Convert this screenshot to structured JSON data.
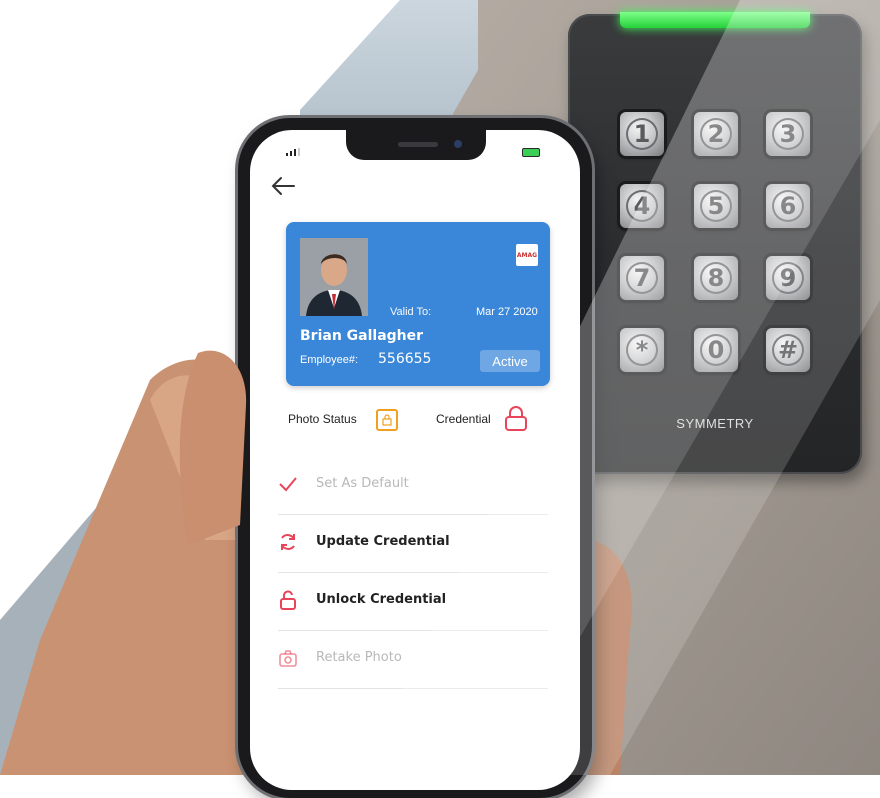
{
  "device": {
    "keys": [
      "1",
      "2",
      "3",
      "4",
      "5",
      "6",
      "7",
      "8",
      "9",
      "*",
      "0",
      "#"
    ],
    "brand": "SYMMETRY"
  },
  "app": {
    "card": {
      "valid_label": "Valid To:",
      "valid_date": "Mar 27 2020",
      "name": "Brian Gallagher",
      "employee_label": "Employee#:",
      "employee_number": "556655",
      "status": "Active",
      "logo_text": "AMAG"
    },
    "photo_status_label": "Photo Status",
    "credential_label": "Credential",
    "menu": [
      {
        "label": "Set As Default",
        "icon": "check-icon"
      },
      {
        "label": "Update Credential",
        "icon": "refresh-icon"
      },
      {
        "label": "Unlock Credential",
        "icon": "unlock-icon"
      },
      {
        "label": "Retake Photo",
        "icon": "camera-icon"
      }
    ]
  },
  "colors": {
    "card": "#3a86d8",
    "accent": "#e8455a",
    "photo_status": "#f0a020",
    "led": "#25d13a"
  }
}
